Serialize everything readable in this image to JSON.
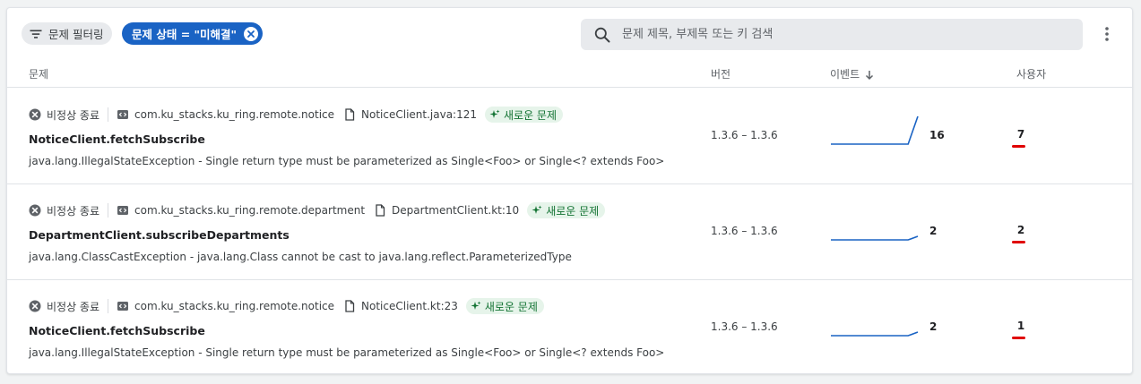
{
  "toolbar": {
    "filter_chip_label": "문제 필터링",
    "active_filter_label": "문제 상태 = \"미해결\"",
    "search_placeholder": "문제 제목, 부제목 또는 키 검색"
  },
  "columns": {
    "issue": "문제",
    "version": "버전",
    "events": "이벤트",
    "users": "사용자"
  },
  "icons": {
    "filter": "filter-list-icon",
    "close": "close-circle-icon",
    "search": "search-icon",
    "more": "more-vert-icon",
    "crash": "crash-x-circle-icon",
    "package": "code-package-icon",
    "file": "file-icon",
    "new": "sparkle-icon",
    "sort": "arrow-down-icon"
  },
  "colors": {
    "accent": "#1a63c4",
    "new_badge_bg": "#e6f4ea",
    "new_badge_text": "#137333",
    "user_mark": "#e00000",
    "sparkline": "#1a63c4"
  },
  "issues": [
    {
      "type": "비정상 종료",
      "package": "com.ku_stacks.ku_ring.remote.notice",
      "file": "NoticeClient.java:121",
      "badge": "새로운 문제",
      "title": "NoticeClient.fetchSubscribe",
      "description": "java.lang.IllegalStateException - Single return type must be parameterized as Single<Foo> or Single<? extends Foo>",
      "version": "1.3.6 – 1.3.6",
      "events": "16",
      "events_trend": [
        0,
        0,
        0,
        0,
        0,
        0,
        0,
        0,
        0,
        16
      ],
      "users": "7"
    },
    {
      "type": "비정상 종료",
      "package": "com.ku_stacks.ku_ring.remote.department",
      "file": "DepartmentClient.kt:10",
      "badge": "새로운 문제",
      "title": "DepartmentClient.subscribeDepartments",
      "description": "java.lang.ClassCastException - java.lang.Class cannot be cast to java.lang.reflect.ParameterizedType",
      "version": "1.3.6 – 1.3.6",
      "events": "2",
      "events_trend": [
        0,
        0,
        0,
        0,
        0,
        0,
        0,
        0,
        0,
        2
      ],
      "users": "2"
    },
    {
      "type": "비정상 종료",
      "package": "com.ku_stacks.ku_ring.remote.notice",
      "file": "NoticeClient.kt:23",
      "badge": "새로운 문제",
      "title": "NoticeClient.fetchSubscribe",
      "description": "java.lang.IllegalStateException - Single return type must be parameterized as Single<Foo> or Single<? extends Foo>",
      "version": "1.3.6 – 1.3.6",
      "events": "2",
      "events_trend": [
        0,
        0,
        0,
        0,
        0,
        0,
        0,
        0,
        0,
        2
      ],
      "users": "1"
    }
  ]
}
